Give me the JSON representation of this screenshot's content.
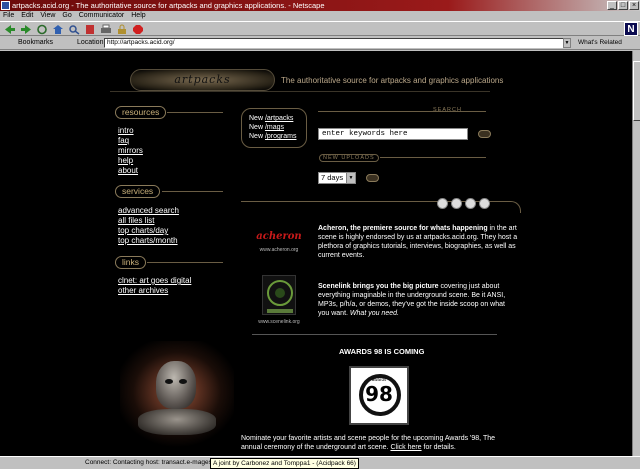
{
  "window": {
    "title": "artpacks.acid.org - The authoritative source for artpacks and graphics applications. - Netscape"
  },
  "menu": [
    "File",
    "Edit",
    "View",
    "Go",
    "Communicator",
    "Help"
  ],
  "location": {
    "bookmarks_label": "Bookmarks",
    "location_label": "Location:",
    "url": "http://artpacks.acid.org/",
    "related_label": "What's Related"
  },
  "page": {
    "tagline": "The authoritative source for artpacks and graphics applications",
    "sections": {
      "resources": {
        "label": "resources",
        "links": [
          "intro",
          "faq",
          "mirrors",
          "help",
          "about"
        ]
      },
      "services": {
        "label": "services",
        "links": [
          "advanced search",
          "all files list",
          "top charts/day",
          "top charts/month"
        ]
      },
      "links": {
        "label": "links",
        "links": [
          "clnet: art goes digital",
          "other archives"
        ]
      }
    },
    "newbox": [
      {
        "new": "New",
        "target": "/artpacks"
      },
      {
        "new": "New",
        "target": "/mags"
      },
      {
        "new": "New",
        "target": "/programs"
      }
    ],
    "search": {
      "label": "SEARCH",
      "value": "enter keywords here"
    },
    "new_uploads": {
      "label": "NEW UPLOADS",
      "selected": "7 days"
    },
    "entries": [
      {
        "caption": "www.acheron.org",
        "headline": "Acheron, the premiere source for whats happening",
        "body": " in the art scene is highly endorsed by us at artpacks.acid.org. They host a plethora of graphics tutorials, interviews, biographies, as well as current events."
      },
      {
        "caption": "www.scenelink.org",
        "headline": "Scenelink brings you the big picture",
        "body": " covering just about everything imaginable in the underground scene. Be it ANSI, MP3s, p/h/a, or demos, they've got the inside scoop on what you want. ",
        "emph": "What you need."
      }
    ],
    "awards": {
      "title": "AWARDS 98 IS COMING",
      "image_text": "98",
      "image_small": "awards",
      "body": "Nominate your favorite artists and scene people for the upcoming Awards '98, The annual ceremony of the underground art scene.",
      "link": "Click here",
      "tail": " for details."
    }
  },
  "status": {
    "text": "Connect: Contacting host: transact.e-mages.com...",
    "tooltip": "A joint by Carbonez and Tomppa1 - (Acidpack 66)"
  },
  "colors": {
    "accent": "#c9b07a",
    "title_bar": "#6b0a0a"
  }
}
